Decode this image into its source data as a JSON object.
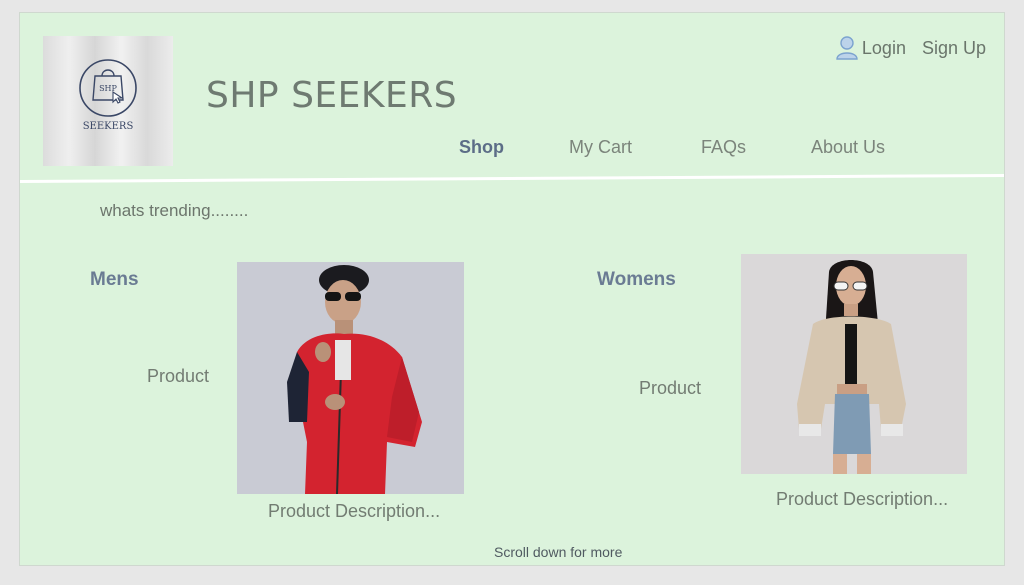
{
  "header": {
    "title": "SHP SEEKERS",
    "logo": {
      "line1": "SHP",
      "line2": "SEEKERS"
    },
    "auth": {
      "login": "Login",
      "signup": "Sign Up"
    }
  },
  "nav": {
    "items": [
      {
        "label": "Shop",
        "active": true
      },
      {
        "label": "My Cart",
        "active": false
      },
      {
        "label": "FAQs",
        "active": false
      },
      {
        "label": "About Us",
        "active": false
      }
    ]
  },
  "main": {
    "trending": "whats trending........",
    "sections": [
      {
        "label": "Mens",
        "product_label": "Product",
        "description": "Product Description..."
      },
      {
        "label": "Womens",
        "product_label": "Product",
        "description": "Product Description..."
      }
    ],
    "scroll_hint": "Scroll down for more"
  },
  "colors": {
    "background": "#dcf3dc",
    "accent": "#5c6d87",
    "text": "#737c73"
  },
  "icons": [
    "user-icon",
    "shopping-bag-icon",
    "cursor-icon"
  ]
}
